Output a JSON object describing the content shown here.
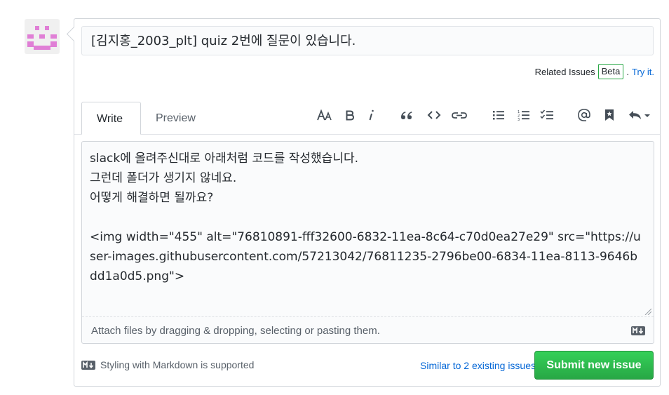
{
  "issue": {
    "title_value": "[김지홍_2003_plt] quiz 2번에 질문이 있습니다.",
    "related_label": "Related Issues",
    "beta_label": "Beta",
    "try_label": "Try it."
  },
  "tabs": [
    {
      "label": "Write",
      "active": true
    },
    {
      "label": "Preview",
      "active": false
    }
  ],
  "toolbar_icons": [
    "text-size-icon",
    "bold-icon",
    "italic-icon",
    "quote-icon",
    "code-icon",
    "link-icon",
    "unordered-list-icon",
    "ordered-list-icon",
    "task-list-icon",
    "mention-icon",
    "saved-reply-icon",
    "reply-icon"
  ],
  "editor": {
    "body": "slack에 올려주신대로 아래처럼 코드를 작성했습니다.\n그런데 폴더가 생기지 않네요.\n어떻게 해결하면 될까요?\n\n<img width=\"455\" alt=\"76810891-fff32600-6832-11ea-8c64-c70d0ea27e29\" src=\"https://user-images.githubusercontent.com/57213042/76811235-2796be00-6834-11ea-8113-9646bdd1a0d5.png\">",
    "attach_hint": "Attach files by dragging & dropping, selecting or pasting them."
  },
  "footer": {
    "markdown_label": "Styling with Markdown is supported",
    "similar_label": "Similar to 2 existing issues",
    "submit_label": "Submit new issue"
  },
  "colors": {
    "accent": "#28a745",
    "link": "#0366d6",
    "avatar": "#e07fd6"
  }
}
